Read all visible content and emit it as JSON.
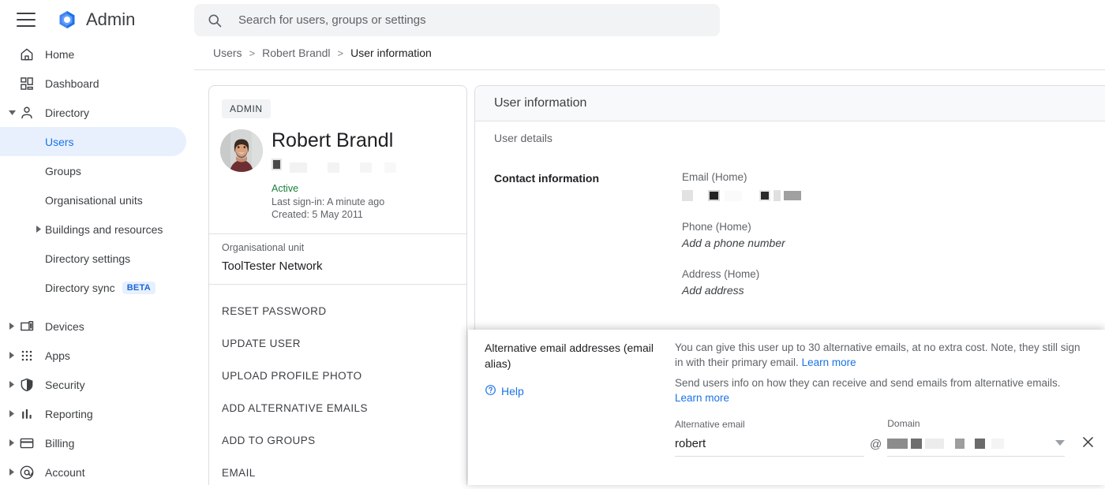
{
  "app": {
    "brand": "Admin",
    "menu_icon": "hamburger-icon",
    "logo_icon": "google-admin-logo"
  },
  "search": {
    "placeholder": "Search for users, groups or settings",
    "value": "",
    "icon": "search-icon"
  },
  "breadcrumb": [
    {
      "label": "Users",
      "current": false
    },
    {
      "label": "Robert Brandl",
      "current": false
    },
    {
      "label": "User information",
      "current": true
    }
  ],
  "sidebar": {
    "items": [
      {
        "label": "Home",
        "icon": "home-icon",
        "level": 0,
        "expandable": false,
        "selected": false
      },
      {
        "label": "Dashboard",
        "icon": "dashboard-icon",
        "level": 0,
        "expandable": false,
        "selected": false
      },
      {
        "label": "Directory",
        "icon": "person-icon",
        "level": 0,
        "expandable": true,
        "expanded": true,
        "selected": false
      },
      {
        "label": "Users",
        "icon": "",
        "level": 1,
        "expandable": false,
        "selected": true
      },
      {
        "label": "Groups",
        "icon": "",
        "level": 1,
        "expandable": false,
        "selected": false
      },
      {
        "label": "Organisational units",
        "icon": "",
        "level": 1,
        "expandable": false,
        "selected": false
      },
      {
        "label": "Buildings and resources",
        "icon": "",
        "level": 1,
        "expandable": true,
        "expanded": false,
        "selected": false
      },
      {
        "label": "Directory settings",
        "icon": "",
        "level": 1,
        "expandable": false,
        "selected": false
      },
      {
        "label": "Directory sync",
        "icon": "",
        "level": 1,
        "expandable": false,
        "selected": false,
        "badge": "BETA"
      },
      {
        "label": "Devices",
        "icon": "devices-icon",
        "level": 0,
        "expandable": true,
        "expanded": false,
        "selected": false
      },
      {
        "label": "Apps",
        "icon": "apps-grid-icon",
        "level": 0,
        "expandable": true,
        "expanded": false,
        "selected": false
      },
      {
        "label": "Security",
        "icon": "shield-icon",
        "level": 0,
        "expandable": true,
        "expanded": false,
        "selected": false
      },
      {
        "label": "Reporting",
        "icon": "bar-chart-icon",
        "level": 0,
        "expandable": true,
        "expanded": false,
        "selected": false
      },
      {
        "label": "Billing",
        "icon": "credit-card-icon",
        "level": 0,
        "expandable": true,
        "expanded": false,
        "selected": false
      },
      {
        "label": "Account",
        "icon": "at-circle-icon",
        "level": 0,
        "expandable": true,
        "expanded": false,
        "selected": false
      }
    ]
  },
  "profile": {
    "badge": "ADMIN",
    "name": "Robert Brandl",
    "avatar_icon": "user-photo-avatar",
    "email_redacted": true,
    "status": "Active",
    "last_sign_in": "Last sign-in: A minute ago",
    "created": "Created: 5 May 2011",
    "org_unit_label": "Organisational unit",
    "org_unit_value": "ToolTester Network",
    "actions": [
      "RESET PASSWORD",
      "UPDATE USER",
      "UPLOAD PROFILE PHOTO",
      "ADD ALTERNATIVE EMAILS",
      "ADD TO GROUPS",
      "EMAIL"
    ]
  },
  "user_information": {
    "panel_title": "User information",
    "section_label": "User details",
    "contact_label": "Contact information",
    "fields": [
      {
        "name": "Email (Home)",
        "value_redacted": true,
        "hint": ""
      },
      {
        "name": "Phone (Home)",
        "value_redacted": false,
        "hint": "Add a phone number"
      },
      {
        "name": "Address (Home)",
        "value_redacted": false,
        "hint": "Add address"
      }
    ]
  },
  "alias_overlay": {
    "title": "Alternative email addresses (email alias)",
    "help_label": "Help",
    "help_icon": "help-circle-icon",
    "description_1": "You can give this user up to 30 alternative emails, at no extra cost. Note, they still sign in with their primary email.",
    "learn_more_1": "Learn more",
    "description_2": "Send users info on how they can receive and send emails from alternative emails.",
    "learn_more_2": "Learn more",
    "alt_email_label": "Alternative email",
    "alt_email_value": "robert",
    "at_symbol": "@",
    "domain_label": "Domain",
    "domain_value_redacted": true,
    "dropdown_icon": "chevron-down-icon",
    "close_icon": "close-icon"
  },
  "colors": {
    "accent_blue": "#1a73e8",
    "selected_bg": "#e8f0fe",
    "status_green": "#188038",
    "text_primary": "#202124",
    "text_secondary": "#5f6368",
    "border": "#dadce0",
    "header_bg": "#f8f9fa"
  }
}
